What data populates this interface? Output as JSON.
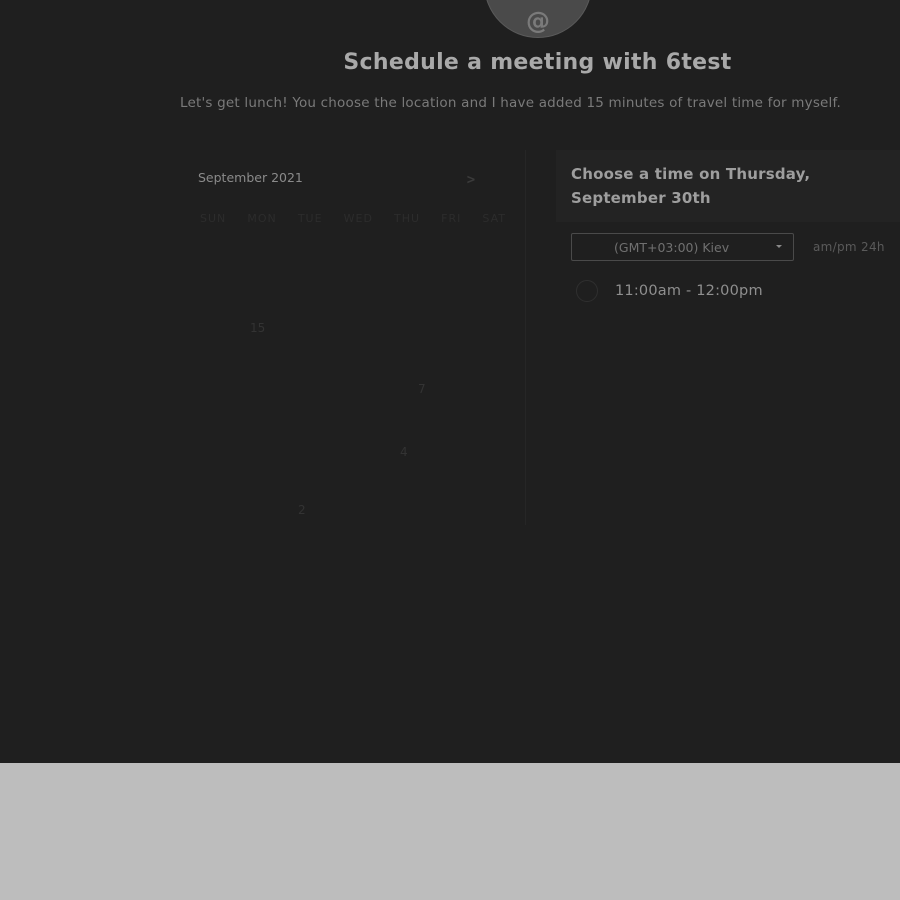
{
  "header": {
    "title": "Schedule a meeting with 6test",
    "subtitle": "Let's get lunch! You choose the location and I have added 15 minutes of travel time for myself."
  },
  "avatar": {
    "glyph": "@"
  },
  "calendar": {
    "month": "September 2021",
    "next_icon": "chevron-right-icon",
    "weekday_labels": [
      "SUN",
      "MON",
      "TUE",
      "WED",
      "THU",
      "FRI",
      "SAT"
    ],
    "visible_days": [
      "15",
      "7",
      "4",
      "2"
    ]
  },
  "time_picker": {
    "heading": "Choose a time on Thursday, September 30th",
    "timezone": "(GMT+03:00) Kiev",
    "time_format": "am/pm 24h",
    "slots": [
      "11:00am - 12:00pm"
    ]
  }
}
